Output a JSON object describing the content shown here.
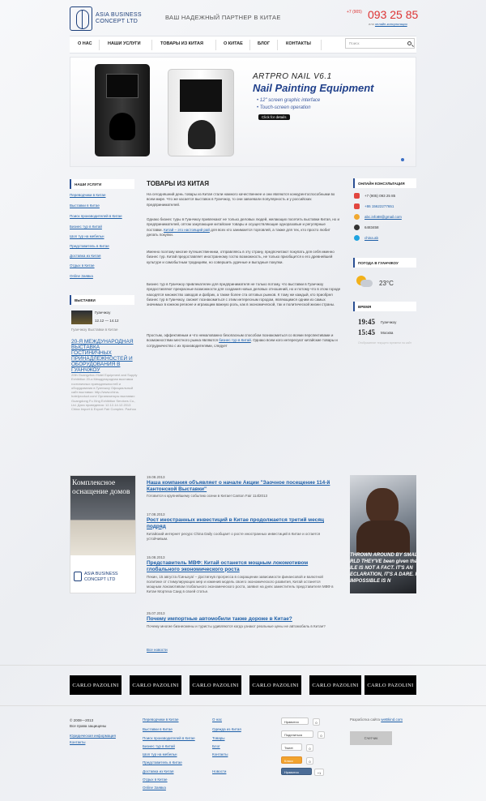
{
  "header": {
    "logo_line1": "ASIA BUSINESS",
    "logo_line2": "CONCEPT LTD",
    "slogan": "ВАШ НАДЕЖНЫЙ ПАРТНЕР В КИТАЕ",
    "phone_code": "+7 (905)",
    "phone": "093 25 85",
    "online_prefix": "или",
    "online_link": "онлайн-консультация"
  },
  "nav": {
    "items": [
      "О нас",
      "Наши услуги",
      "Товары из Китая",
      "О Китае",
      "Блог",
      "Контакты"
    ],
    "search_placeholder": "Поиск"
  },
  "banner": {
    "brand": "ARTPRO NAIL V6.1",
    "subtitle": "Nail Painting Equipment",
    "bullets": [
      "• 12\" screen graphic interface",
      "• Touch-screen operation"
    ],
    "button": "Click for details"
  },
  "left": {
    "services_heading": "Наши услуги",
    "services": [
      "Переводчики в Китае",
      "Выставки в Китае",
      "Поиск производителей в Китае",
      "Бизнес тур в Китай",
      "Шоп тур на мебельн",
      "Представитель в Китае",
      "Доставка из Китая",
      "Отдых в Китае",
      "Online Заявка"
    ],
    "expo_heading": "Выставки",
    "expo_city": "Гуанчжоу",
    "expo_dates": "12.12 — 14.12",
    "expo_caption": "Гуанчжоу Выставки в Китае",
    "expo_title": "20-Я МЕЖДУНАРОДНАЯ ВЫСТАВКА ГОСТИНИЧНЫХ ПРИНАДЛЕЖНОСТЕЙ И ОБОРУДОВАНИЯ В ГУАНЧЖОУ",
    "expo_desc": "20th Guangzhou Hotel Equipment and Supply Exhibition 20-я Международная выставка гостиничных принадлежностей и оборудования в Гуанчжоу Официальный сайт выставки: http://www.china-hotelproduct.com/ Организаторы выставки: Guangdong Fu Xing Exhibition Services Co., Ltd. Дата проведения: 12.12-14.12.2013 China Import & Export Fair Complex. Pazhou"
  },
  "main": {
    "title": "Товары из Китая",
    "p1": "На сегодняшний день товары из Китая стали намного качественнее и они являются конкурентоспособными во всем мире. Что же касается выставок в Гуанчжоу, то они завоевали популярность и у российских предпринимателей.",
    "p2a": "Однако бизнес туры в Гуанчжоу привлекают не только деловых людей, желающих посетить выставки Китая, но и предпринимателей, оптом закупающие китайские товары и осуществляющие одноразовые и регулярные поставки. ",
    "p2link": "Китай – это настоящий рай",
    "p2b": " для всех кто занимается торговлей, а также для тех, кто просто любит делать покупки.",
    "p3": "Именно поэтому многие путешественники, отправляясь в эту страну, предпочитают покупать для себя именно бизнес тур. Китай предоставляет иностранному гостю возможность, не только приобщится к его древнейшей культуре и самобытным традициям, но совершить удачные и выгодные покупки.",
    "p4": "Бизнес тур в Гуанчжоу привлекателен для предпринимателя не только потому, что выставки в Гуанчжоу предоставляют прекрасные возможности для создания новых деловых отношений, но и потому что в этом городе находятся множество заводов и фабрик, а также более ста оптовых рынков. К тому же каждый, кто приобрел бизнес тур в Гуанчжоу, сможет познакомиться с этим интересным городом, являющимся одним из самых значимых в южном регионе и играющим важную роль, как в экономической, так и политической жизни страны.",
    "p5a": "Простым, эффективным и что немаловажно безопасным способом познакомиться со всеми перспективами и возможностями местного рынка являются ",
    "p5link": "бизнес тур в Китай",
    "p5b": ". Однако всем кого интересуют китайские товары и сотрудничество с их производителями, следует"
  },
  "right": {
    "consult_heading": "Онлайн консультация",
    "contacts": [
      {
        "icon": "phone-icon",
        "text": "+7 (905) 093 25 85",
        "color": "#e2463f"
      },
      {
        "icon": "phone-icon",
        "text": "+86 15622277651",
        "color": "#e2463f"
      },
      {
        "icon": "email-icon",
        "text": "abc.info88@gmail.com",
        "color": "#f0a830"
      },
      {
        "icon": "qq-icon",
        "text": "6483458",
        "color": "#333333"
      },
      {
        "icon": "skype-icon",
        "text": "china.ab",
        "color": "#1fa3e0"
      }
    ],
    "weather_heading": "Погода в Гуанчжоу",
    "temperature": "23°C",
    "time_heading": "Время",
    "times": [
      {
        "time": "19:45",
        "city": "Гуанчжоу"
      },
      {
        "time": "15:45",
        "city": "Москва"
      }
    ],
    "time_note": "Отображение текущего времени на сайт"
  },
  "promo": {
    "title": "Комплексное оснащение домов",
    "logo_line1": "ASIA BUSINESS",
    "logo_line2": "CONCEPT LTD"
  },
  "news": {
    "items": [
      {
        "date": "19.08.2013",
        "title": "Наша компания объявляет о начале Акции \"Заочное посещение 114-й Кантонской Выставки\"",
        "text": "Готовится к крупнейшему событию осени в Китае! Canton Fair 114l2013"
      },
      {
        "date": "17.08.2013",
        "title": "Рост иностранных инвестиций в Китае продолжается третий месяц подряд",
        "text": "Китайский интернет ресурс China Daily сообщает о росте иностранных инвестиций в Китае и остается устойчивым."
      },
      {
        "date": "15.08.2013",
        "title": "Представитель МВФ: Китай останется мощным локомотивом глобального экономического роста",
        "text": "Пекин, 15 августа /Синьхуа/ -- Достигнув прогресса в сокращении зависимости финансовой и валютной политике от стимулирующих мер и изменив модель своего экономического развития, Китай останется мощным локомотивом глобального экономического роста, заявил на днях заместитель представителя МВФ в Китае Мортеза Саид в своей статье."
      },
      {
        "date": "25.07.2013",
        "title": "Почему импортные автомобили также дороже в Китае?",
        "text": "Почему многие бизнесмены и туристы удивляются когда узнают реальные цены не автомобиль в Китае?"
      }
    ],
    "all_news": "Все новости"
  },
  "ad": {
    "lines": [
      "THROWN AROUND BY SMALL",
      "RLD THEY'VE been given than",
      "ILE IS NOT A FACT. IT'S AN",
      "ECLARATION, IT'S A DARE. IMP",
      "IMPOSSIBLE IS N"
    ]
  },
  "brands": [
    "CARLO PAZOLINI",
    "CARLO PAZOLINI",
    "CARLO PAZOLINI",
    "CARLO PAZOLINI",
    "CARLO PAZOLINI",
    "CARLO PAZOLINI"
  ],
  "footer": {
    "copyright1": "© 2008—2013",
    "copyright2": "Все права защищены",
    "legal": "Юридическая информация",
    "contacts": "Контакты",
    "col1": [
      "Переводчики в Китае",
      "Выставки в Китае",
      "Поиск производителей в Китае",
      "Бизнес тур в Китай",
      "Шоп тур на мебельн",
      "Представитель в Китае",
      "Доставка из Китая",
      "Отдых в Китае",
      "Online Заявка"
    ],
    "col2": [
      "О нас",
      "Одежда из Китая",
      "Товары",
      "Блог",
      "Контакты",
      "Новости"
    ],
    "social": [
      {
        "label": "Нравится",
        "count": "0"
      },
      {
        "label": "Поделиться",
        "count": "0"
      },
      {
        "label": "Tweet",
        "count": "0"
      },
      {
        "label": "Класс",
        "count": "0"
      },
      {
        "label": "Нравится",
        "count": "+1"
      }
    ],
    "dev_label": "Разработка сайта",
    "dev_link": "weBkind.com",
    "counter": "Счетчик"
  }
}
